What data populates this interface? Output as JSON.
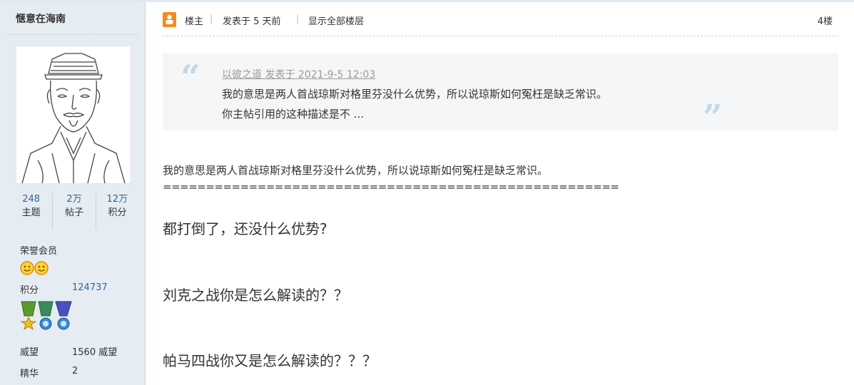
{
  "user": {
    "name": "惬意在海南",
    "stats": [
      {
        "value": "248",
        "label": "主题"
      },
      {
        "value": "2万",
        "label": "帖子"
      },
      {
        "value": "12万",
        "label": "积分"
      }
    ],
    "group": "荣誉会员",
    "rows": [
      {
        "label": "积分",
        "value": "124737"
      },
      {
        "label": "威望",
        "value": "1560 威望"
      },
      {
        "label": "精华",
        "value": "2"
      }
    ]
  },
  "post": {
    "owner_label": "楼主",
    "posted": "发表于 5 天前",
    "show_all": "显示全部楼层",
    "floor": "4楼",
    "quote": {
      "meta": "以彼之道 发表于 2021-9-5 12:03",
      "lines": [
        "我的意思是两人首战琼斯对格里芬没什么优势，所以说琼斯如何冤枉是缺乏常识。",
        "你主帖引用的这种描述是不 ..."
      ]
    },
    "body": {
      "line1": "我的意思是两人首战琼斯对格里芬没什么优势，所以说琼斯如何冤枉是缺乏常识。",
      "divider": "=====================================================",
      "q1": "都打倒了，还没什么优势?",
      "q2": "刘克之战你是怎么解读的？？",
      "q3": "帕马四战你又是怎么解读的？？？"
    }
  }
}
